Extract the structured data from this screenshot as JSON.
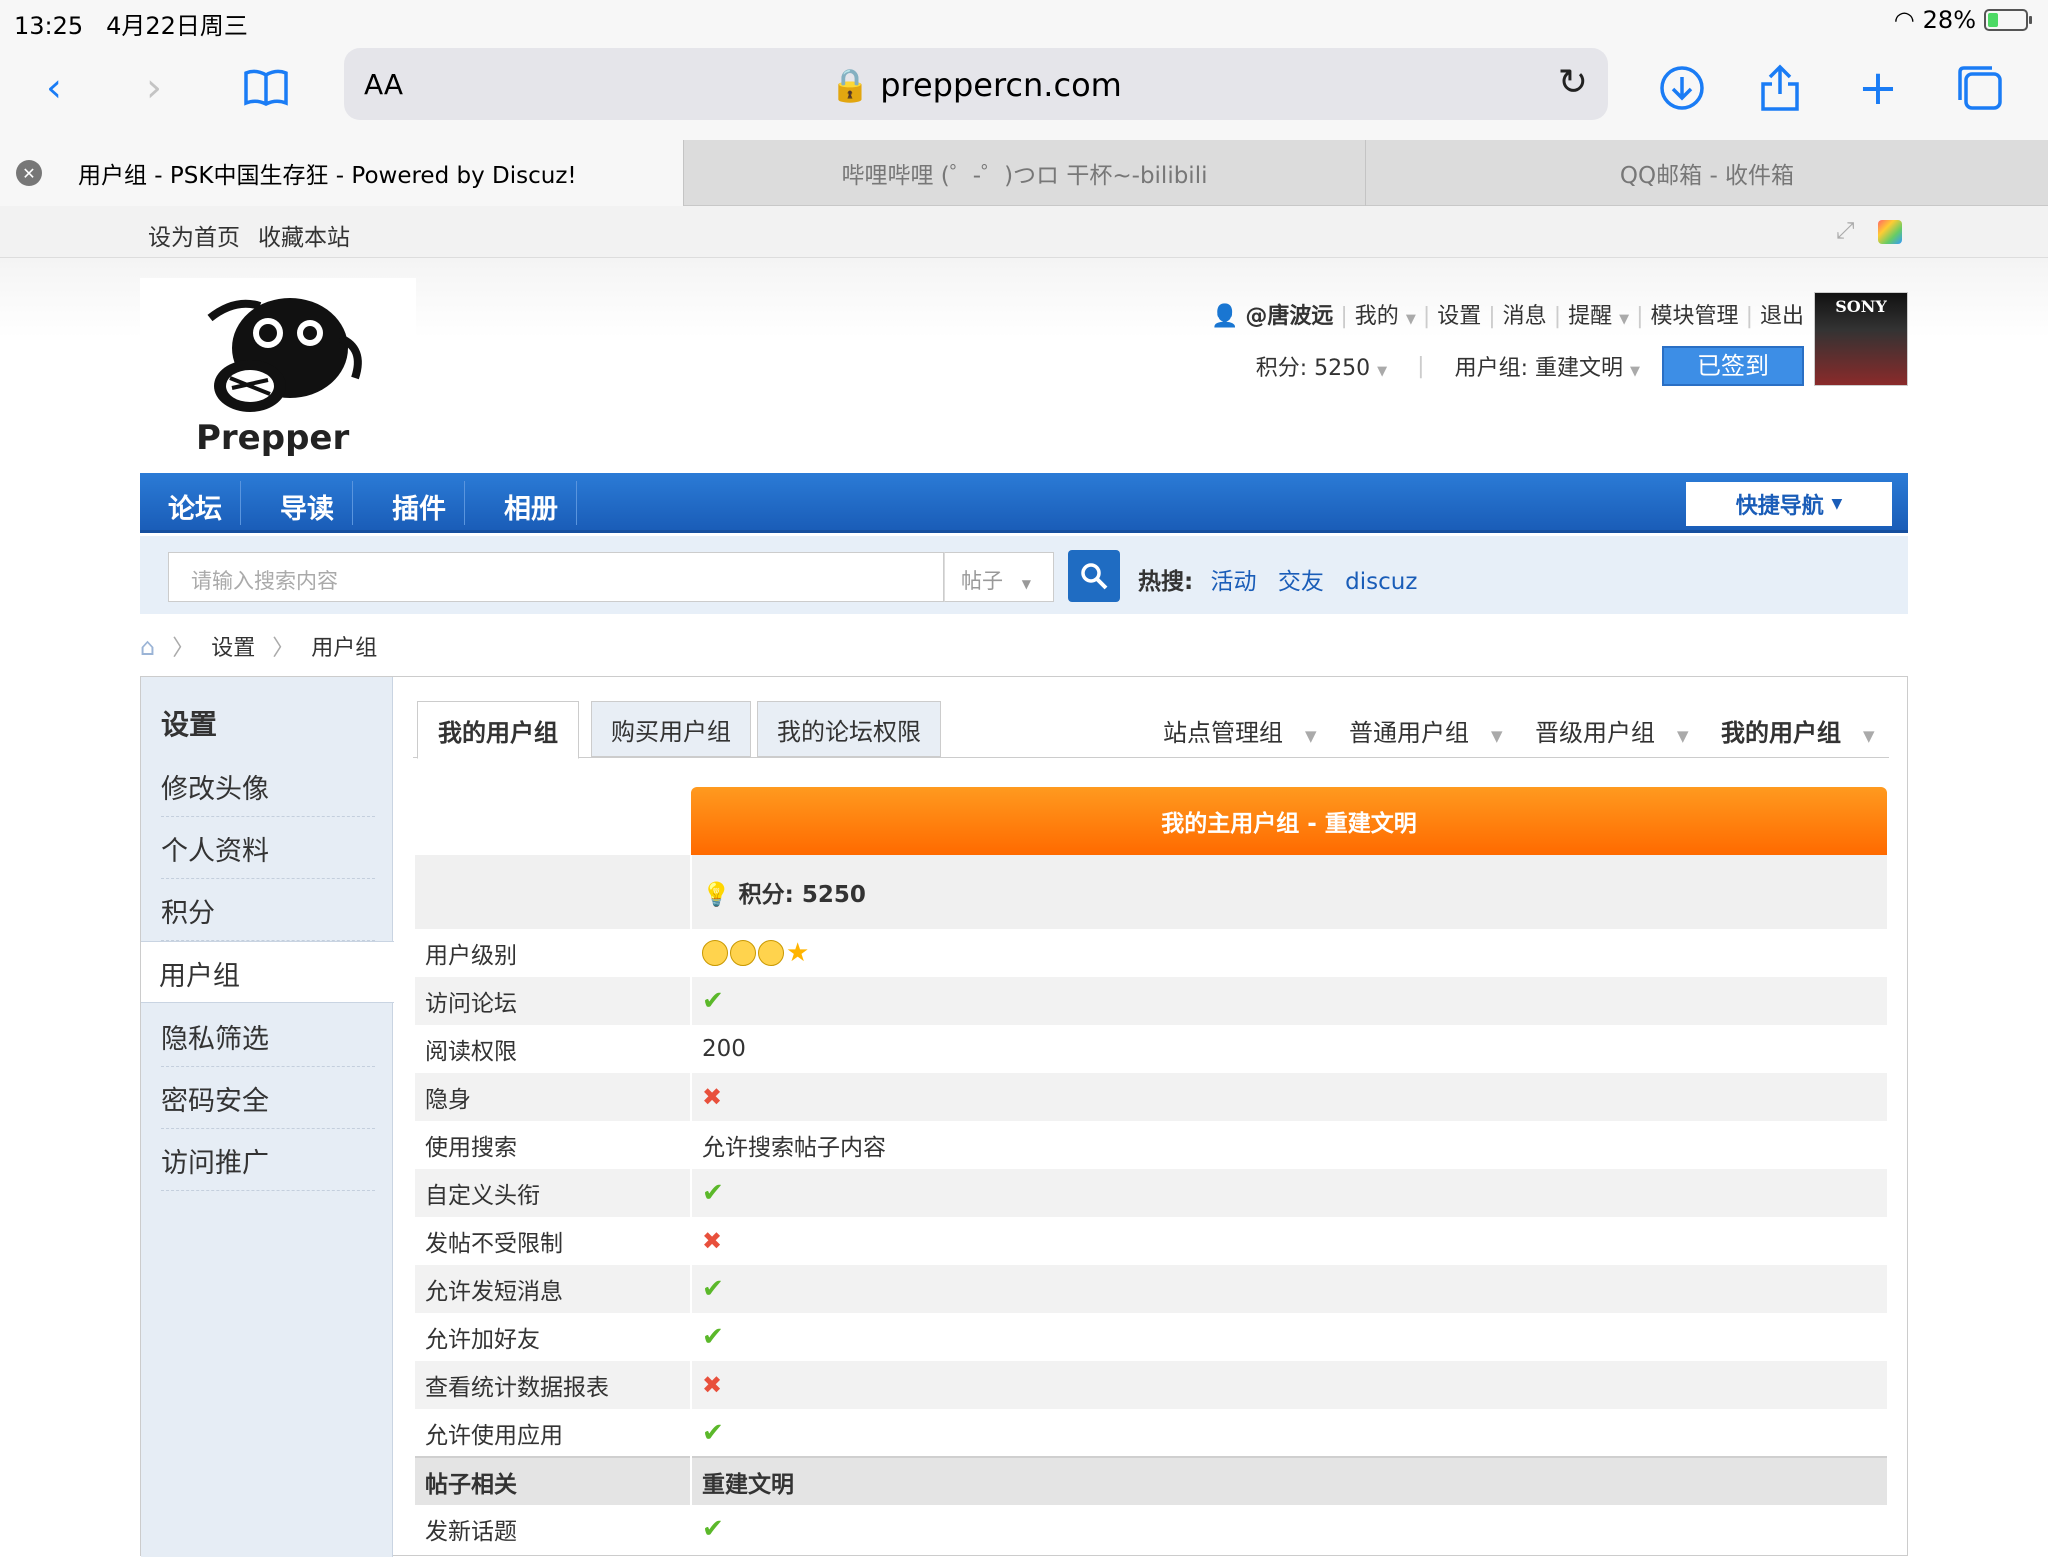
{
  "status": {
    "time": "13:25",
    "date": "4月22日周三",
    "battery": "28%",
    "battery_level": 0.28
  },
  "toolbar": {
    "aa": "AA",
    "url": "preppercn.com"
  },
  "tabs": [
    {
      "label": "用户组 - PSK中国生存狂 - Powered by Discuz!"
    },
    {
      "label": "哔哩哔哩 (゜-゜)つロ 干杯~-bilibili"
    },
    {
      "label": "QQ邮箱 - 收件箱"
    }
  ],
  "toplinks": {
    "home": "设为首页",
    "fav": "收藏本站"
  },
  "logo": {
    "text": "Prepper"
  },
  "user": {
    "name": "@唐波远",
    "mine": "我的",
    "settings": "设置",
    "messages": "消息",
    "remind": "提醒",
    "module": "模块管理",
    "logout": "退出",
    "score": "积分: 5250",
    "group": "用户组: 重建文明",
    "signed": "已签到",
    "avatar_text": "SONY"
  },
  "nav": {
    "items": [
      "论坛",
      "导读",
      "插件",
      "相册"
    ],
    "quick": "快捷导航"
  },
  "search": {
    "placeholder": "请输入搜索内容",
    "type": "帖子",
    "hot_label": "热搜:",
    "hot": [
      "活动",
      "交友",
      "discuz"
    ]
  },
  "crumb": [
    "设置",
    "用户组"
  ],
  "side": {
    "title": "设置",
    "items": [
      "修改头像",
      "个人资料",
      "积分",
      "用户组",
      "隐私筛选",
      "密码安全",
      "访问推广"
    ]
  },
  "ctabs": [
    "我的用户组",
    "购买用户组",
    "我的论坛权限"
  ],
  "rnav": [
    "站点管理组",
    "普通用户组",
    "晋级用户组",
    "我的用户组"
  ],
  "main_group": "我的主用户组 - 重建文明",
  "score": "积分: 5250",
  "rows": [
    {
      "k": "用户级别",
      "v": "faces"
    },
    {
      "k": "访问论坛",
      "v": "yes"
    },
    {
      "k": "阅读权限",
      "v": "200"
    },
    {
      "k": "隐身",
      "v": "no"
    },
    {
      "k": "使用搜索",
      "v": "允许搜索帖子内容"
    },
    {
      "k": "自定义头衔",
      "v": "yes"
    },
    {
      "k": "发帖不受限制",
      "v": "no"
    },
    {
      "k": "允许发短消息",
      "v": "yes"
    },
    {
      "k": "允许加好友",
      "v": "yes"
    },
    {
      "k": "查看统计数据报表",
      "v": "no"
    },
    {
      "k": "允许使用应用",
      "v": "yes"
    }
  ],
  "section": {
    "k": "帖子相关",
    "v": "重建文明"
  },
  "last_row": {
    "k": "发新话题",
    "v": "yes"
  }
}
